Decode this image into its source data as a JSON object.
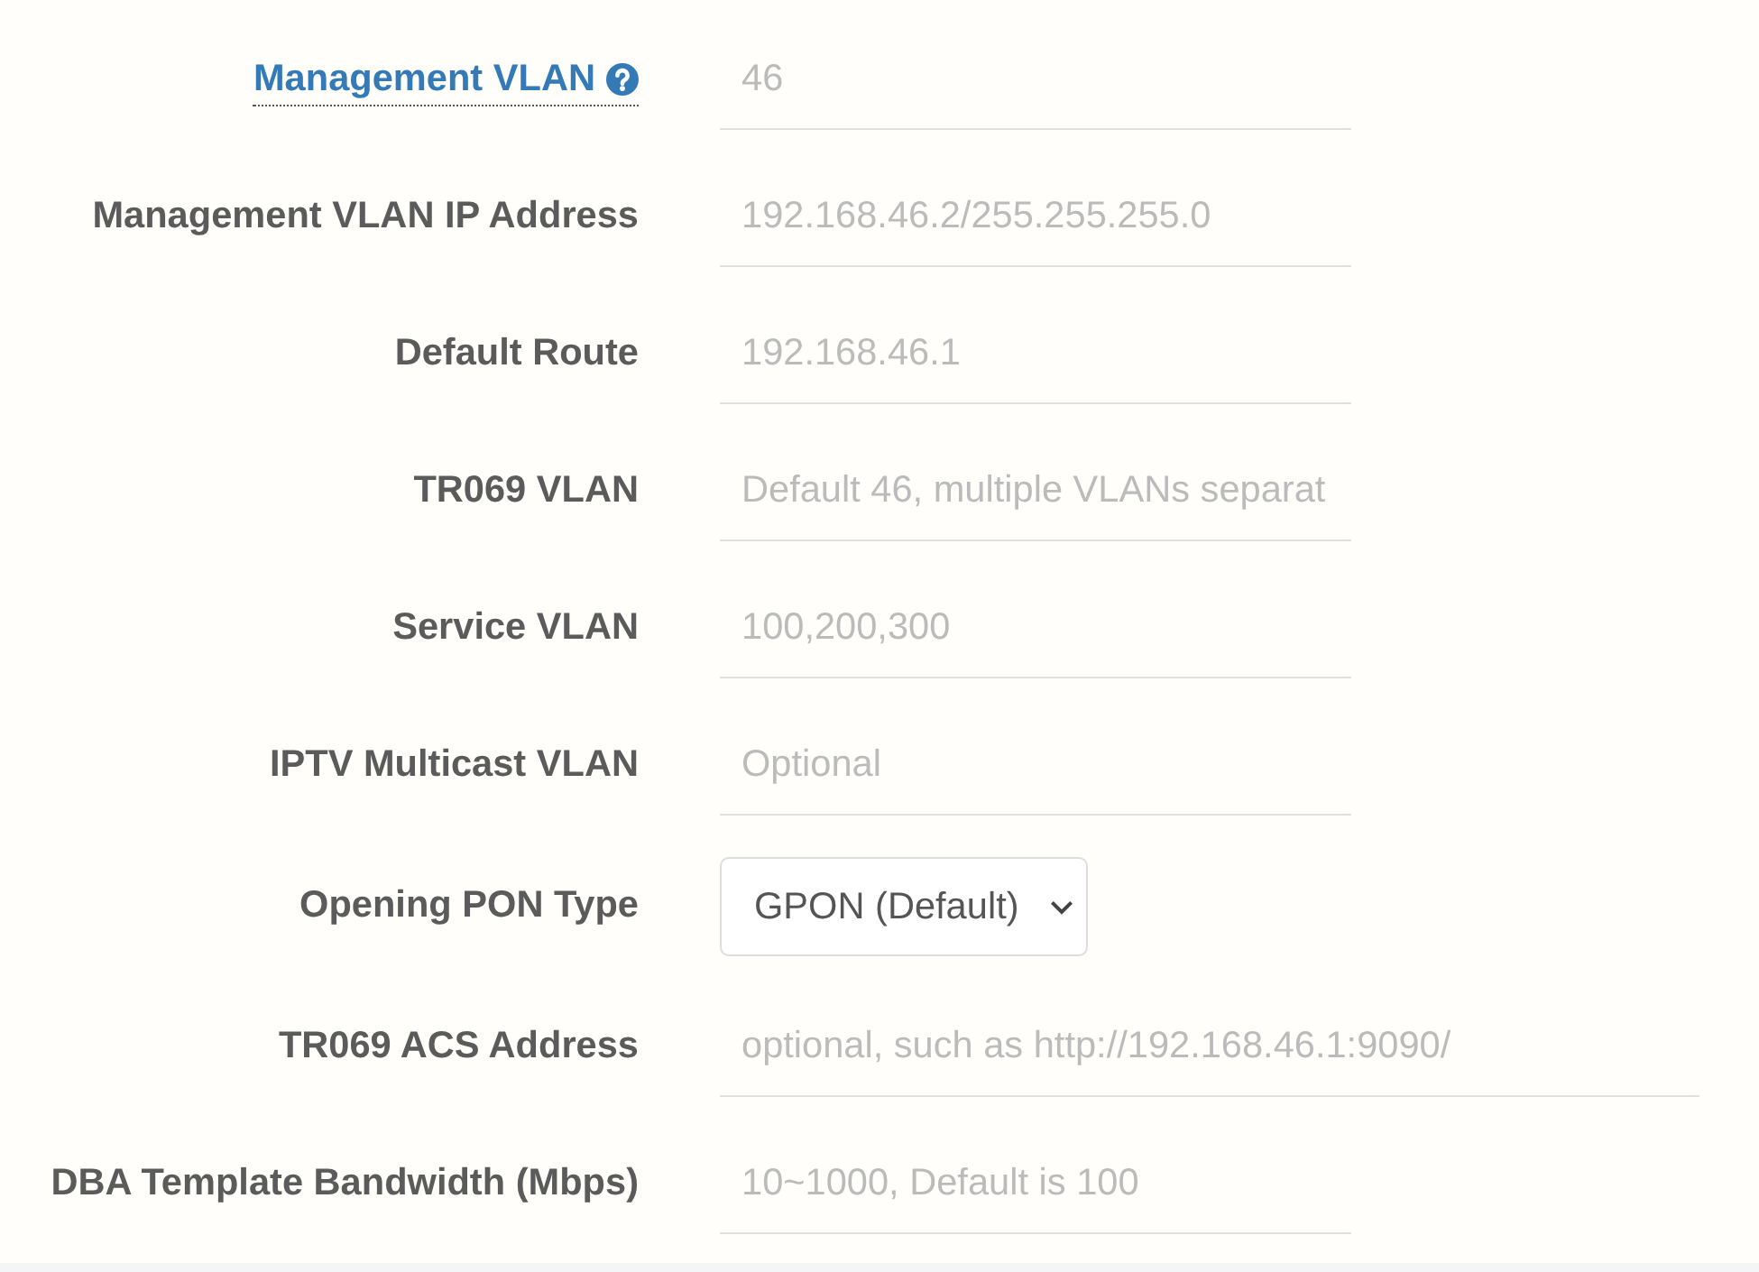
{
  "fields": [
    {
      "label": "Management VLAN",
      "help": true,
      "kind": "text",
      "placeholder": "46",
      "wide": false
    },
    {
      "label": "Management VLAN IP Address",
      "help": false,
      "kind": "text",
      "placeholder": "192.168.46.2/255.255.255.0",
      "wide": false
    },
    {
      "label": "Default Route",
      "help": false,
      "kind": "text",
      "placeholder": "192.168.46.1",
      "wide": false
    },
    {
      "label": "TR069 VLAN",
      "help": false,
      "kind": "text",
      "placeholder": "Default 46, multiple VLANs separat",
      "wide": false
    },
    {
      "label": "Service VLAN",
      "help": false,
      "kind": "text",
      "placeholder": "100,200,300",
      "wide": false
    },
    {
      "label": "IPTV Multicast VLAN",
      "help": false,
      "kind": "text",
      "placeholder": "Optional",
      "wide": false
    },
    {
      "label": "Opening PON Type",
      "help": false,
      "kind": "select",
      "value": "GPON (Default)"
    },
    {
      "label": "TR069 ACS Address",
      "help": false,
      "kind": "text",
      "placeholder": "optional, such as http://192.168.46.1:9090/",
      "wide": true
    },
    {
      "label": "DBA Template Bandwidth (Mbps)",
      "help": false,
      "kind": "text",
      "placeholder": "10~1000, Default is 100",
      "wide": false
    }
  ]
}
